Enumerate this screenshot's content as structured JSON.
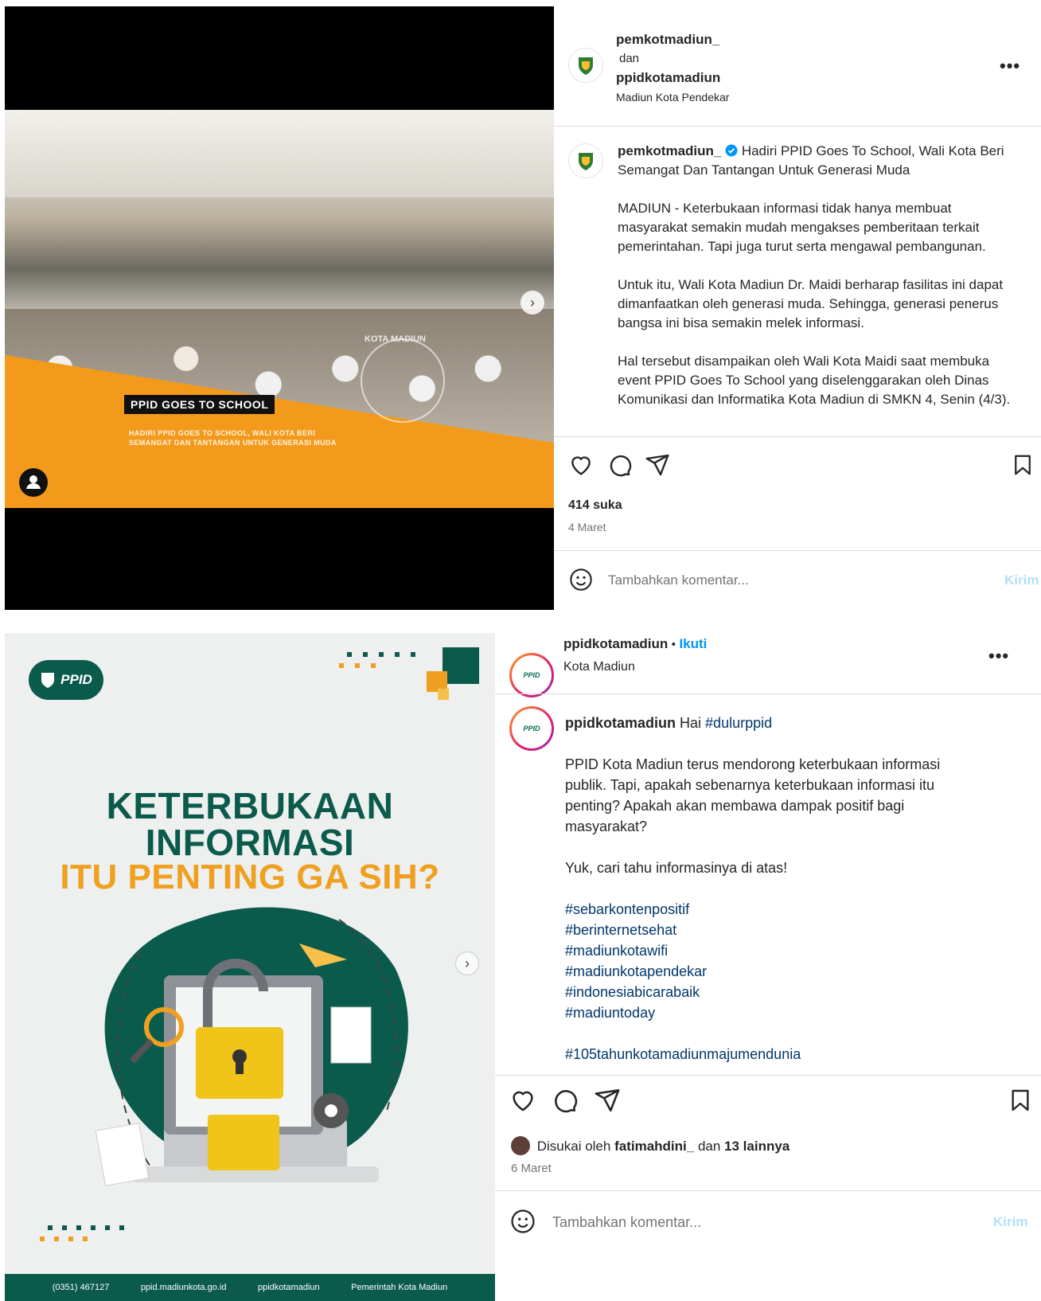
{
  "post1": {
    "header": {
      "user1": "pemkotmadiun_",
      "joiner": "dan",
      "user2": "ppidkotamadiun",
      "location": "Madiun Kota Pendekar"
    },
    "caption": {
      "username": "pemkotmadiun_",
      "title": "Hadiri PPID Goes To School, Wali Kota Beri Semangat Dan Tantangan Untuk Generasi Muda",
      "p1": "MADIUN - Keterbukaan informasi tidak hanya membuat masyarakat semakin mudah mengakses pemberitaan terkait pemerintahan. Tapi juga turut serta mengawal pembangunan.",
      "p2": "Untuk itu, Wali Kota Madiun Dr. Maidi berharap fasilitas ini dapat dimanfaatkan oleh generasi muda. Sehingga, generasi penerus bangsa ini bisa semakin melek informasi.",
      "p3": "Hal tersebut disampaikan oleh Wali Kota Maidi saat membuka event PPID Goes To School yang diselenggarakan oleh Dinas Komunikasi dan Informatika Kota Madiun di SMKN 4, Senin (4/3)."
    },
    "media": {
      "banner_title": "PPID GOES TO SCHOOL",
      "banner_sub_1": "HADIRI PPID GOES TO SCHOOL, WALI KOTA BERI",
      "banner_sub_2": "SEMANGAT DAN TANTANGAN UNTUK GENERASI MUDA",
      "watermark": "KOTA MADIUN"
    },
    "likes": "414 suka",
    "date": "4 Maret",
    "comment_placeholder": "Tambahkan komentar...",
    "send_label": "Kirim"
  },
  "post2": {
    "header": {
      "username": "ppidkotamadiun",
      "separator": "•",
      "follow_label": "Ikuti",
      "location": "Kota Madiun"
    },
    "caption": {
      "username": "ppidkotamadiun",
      "greeting": "Hai",
      "greeting_tag": "#dulurppid",
      "p1": "PPID Kota Madiun terus mendorong keterbukaan informasi publik. Tapi, apakah sebenarnya keterbukaan informasi itu penting? Apakah akan membawa dampak positif bagi masyarakat?",
      "p2": "Yuk, cari tahu informasinya di atas!",
      "hashtags": [
        "#sebarkontenpositif",
        "#berinternetsehat",
        "#madiunkotawifi",
        "#madiunkotapendekar",
        "#indonesiabicarabaik",
        "#madiuntoday"
      ],
      "hashtag_last": "#105tahunkotamadiunmajumendunia"
    },
    "media": {
      "logo": "PPID",
      "line1": "KETERBUKAAN",
      "line2": "INFORMASI",
      "line3": "ITU PENTING GA SIH?",
      "footer_phone": "(0351) 467127",
      "footer_web": "ppid.madiunkota.go.id",
      "footer_ig": "ppidkotamadiun",
      "footer_fb": "Pemerintah Kota Madiun"
    },
    "liked_prefix": "Disukai oleh",
    "liked_user": "fatimahdini_",
    "liked_joiner": "dan",
    "liked_others": "13 lainnya",
    "date": "6 Maret",
    "comment_placeholder": "Tambahkan komentar...",
    "send_label": "Kirim"
  },
  "colors": {
    "verified": "#0095f6",
    "hashtag": "#00376b",
    "follow": "#0095f6",
    "send_disabled": "#b2dffc",
    "orange_banner": "#f39a1c",
    "ppid_green": "#0b5b4d"
  }
}
